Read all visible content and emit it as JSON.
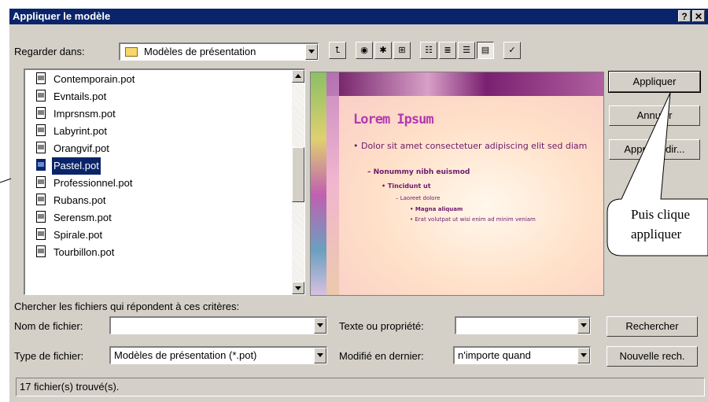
{
  "dialog": {
    "title": "Appliquer le modèle",
    "help_glyph": "?",
    "close_glyph": "✕"
  },
  "look_in": {
    "label": "Regarder dans:",
    "value": "Modèles de présentation"
  },
  "files": [
    {
      "name": "Contemporain.pot"
    },
    {
      "name": "Evntails.pot"
    },
    {
      "name": "Imprsnsm.pot"
    },
    {
      "name": "Labyrint.pot"
    },
    {
      "name": "Orangvif.pot"
    },
    {
      "name": "Pastel.pot",
      "selected": true
    },
    {
      "name": "Professionnel.pot"
    },
    {
      "name": "Rubans.pot"
    },
    {
      "name": "Serensm.pot"
    },
    {
      "name": "Spirale.pot"
    },
    {
      "name": "Tourbillon.pot"
    }
  ],
  "preview": {
    "title": "Lorem Ipsum",
    "bullet1": "• Dolor sit amet consectetuer adipiscing elit sed diam",
    "bullet2": "– Nonummy nibh euismod",
    "bullet3": "• Tincidunt ut",
    "bullet4": "– Laoreet dolore",
    "bullet5": "• Magna aliquam",
    "bullet6": "• Erat volutpat ut wisi enim ad minim veniam"
  },
  "buttons": {
    "apply": "Appliquer",
    "cancel": "Annuler",
    "advanced": "Approfondir...",
    "search": "Rechercher",
    "new_search": "Nouvelle rech."
  },
  "search": {
    "criteria_label": "Chercher les fichiers qui répondent à ces critères:",
    "filename_label": "Nom de fichier:",
    "filename_value": "",
    "text_label": "Texte ou propriété:",
    "text_value": "",
    "filetype_label": "Type de fichier:",
    "filetype_value": "Modèles de présentation (*.pot)",
    "modified_label": "Modifié en dernier:",
    "modified_value": "n'importe quand"
  },
  "status": {
    "text": "17 fichier(s) trouvé(s)."
  },
  "callout": {
    "line1": "Puis clique",
    "line2": "appliquer"
  }
}
